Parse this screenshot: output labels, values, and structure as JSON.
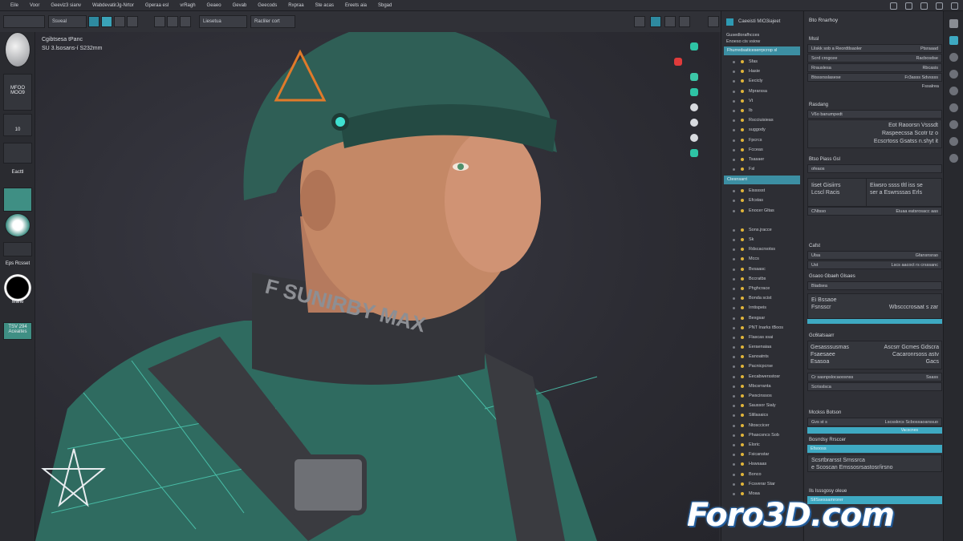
{
  "menu": [
    "Eile",
    "Voor",
    "Geeviz3 sianv",
    "WabdevatirJg-Nrtor",
    "Gperaa esl",
    "vrRagh",
    "Geaeo",
    "Gevab",
    "Geecods",
    "Rxpraa",
    "Ste acas",
    "Ereets aia",
    "Sbgad"
  ],
  "toolbar": {
    "field1": "",
    "field2": "Ssveal",
    "field3": "Liesetua",
    "field4": "Racliler cort"
  },
  "viewport": {
    "info_line1": "Cgibtsesa tPanc",
    "info_line2": "SU 3.lsosans-í S232mm"
  },
  "left_tools": {
    "t1": "MFOO",
    "t2": "MOO9",
    "t3": "10",
    "t4": "Eacttl",
    "t5": "Eps Rcsset",
    "t6": "Mane",
    "t7": "TSV 294 Aceaites"
  },
  "outliner": {
    "header": "Caeeisti MIO3iajeet",
    "sub1": "Gusedlorafhcces",
    "sub2": "Enoeso cis vsiow",
    "selected1": "Fhurredsaticeserrpcrop sl",
    "items_a": [
      "Sfas",
      "Hasie",
      "Eecicly",
      "Mprarssa",
      "Vt",
      "Ib",
      "Rscciuisieas",
      "suggody",
      "Fpcrcs",
      "Fcceas",
      "Tsasaer",
      "Fsl"
    ],
    "selected2": "Ctesnsarri",
    "items_b": [
      "Eissssst",
      "Efcstas",
      "Enocer Gltas"
    ],
    "items_c": [
      "Sons.jracce",
      "Sk",
      "Rdscacrsotss",
      "Mccs",
      "Bvsaasc",
      "Bccratbs",
      "Phghcrace",
      "Bonda scist",
      "Irntispeis",
      "Bexgsar",
      "PNT Inarks tBoos",
      "Flascas ssai",
      "Eeraenaiaa",
      "Eanoatnts",
      "Pacnicpcrse",
      "Eecabwersstosr",
      "Mbcsrranta",
      "Pwscinssos",
      "Saussor Sialy",
      "Slillasaics",
      "Ntosccicer",
      "Phascsncs Sob",
      "Eloric",
      "Fsicanstar",
      "Hswsaas",
      "Bonco",
      "Fcsverar Star",
      "Moaa"
    ]
  },
  "props": {
    "title": "Bto Rnarhoy",
    "sec1": "Mssl",
    "rows1": [
      [
        "Lliskk sob a Reordtlsaoler",
        "Ptsraaad"
      ],
      [
        "Scrd crogcee",
        "Racbosdse"
      ],
      [
        "Rrauslesa",
        "Rbcasis"
      ],
      [
        "Btsssrsslasese",
        "Fr3asss Sdvssss"
      ]
    ],
    "row1_extra": "Fssalrea",
    "sec2": "Rasdang",
    "sec2_field": "V6o banumpedt",
    "sec2_box": [
      "Eot Raoorsn Vsssdt",
      "Raspeecssa Scotr tz o",
      "Ecscrtoss Gsatss n.shyt it"
    ],
    "sec3": "Btso Piass Gsl",
    "sec3_field": "ofeaos",
    "sec3_box_left": [
      "Iiset Gisiirrs",
      "Lcscl Racis"
    ],
    "sec3_box_right": [
      "Eiwsro ssss tltl iss se",
      "ser a Eswrsssas Erls"
    ],
    "sec3_box2_left": "CNtsso",
    "sec3_box2_right": "Eiuaa eatsrosacc aas",
    "sec4": "Cafst",
    "rows4": [
      [
        "Ulsa",
        "Gfansnsrao"
      ],
      [
        "Ust",
        "Lscs aacoct rs crsssanc"
      ]
    ],
    "sec5": "Gsaoo Gbaeh Glsaes",
    "sec5_label": "Bladsea",
    "sec5_sub": "Ei Bssaoe",
    "sec5_sub2": "Fsnsscr",
    "sec5_sub2_right": "Wbscccrosaat s zar",
    "sec6": "Gc6tatsaarr",
    "sec6_box": [
      "Gesasssusmas",
      "Fsaesaee",
      "Esasoa"
    ],
    "sec6_box_right": [
      "Ascsrr Gcmes Gdscra",
      "Cacaronrsoss astv",
      "Gacs"
    ],
    "sec6_row": [
      "Cr sasnpslocaoosnss",
      "Ssass"
    ],
    "sec6_row2": "Scrisslsca",
    "sec7": "Mcckss Botson",
    "sec7_row": [
      "Gvs st s",
      "Lscsskrcs Scbosxaoarssuo"
    ],
    "sec7_bar": "Vacscnes",
    "sec7_sub": "Bosrrdsy Rrsccer",
    "sec7_bar2": "Efsooss",
    "sec7_rows": [
      "Scsrtbrarsst Srnssrca",
      "e Scoscan Emssosrsastosr/irsno"
    ],
    "sec8": "Ils Isssgosy oleue",
    "sec8_bar": "SlISsessamrorer"
  },
  "watermark": "Foro3D.com",
  "colors": {
    "accent": "#3ea9c2",
    "panel": "#2f3036",
    "dot": "#e0b43a"
  }
}
